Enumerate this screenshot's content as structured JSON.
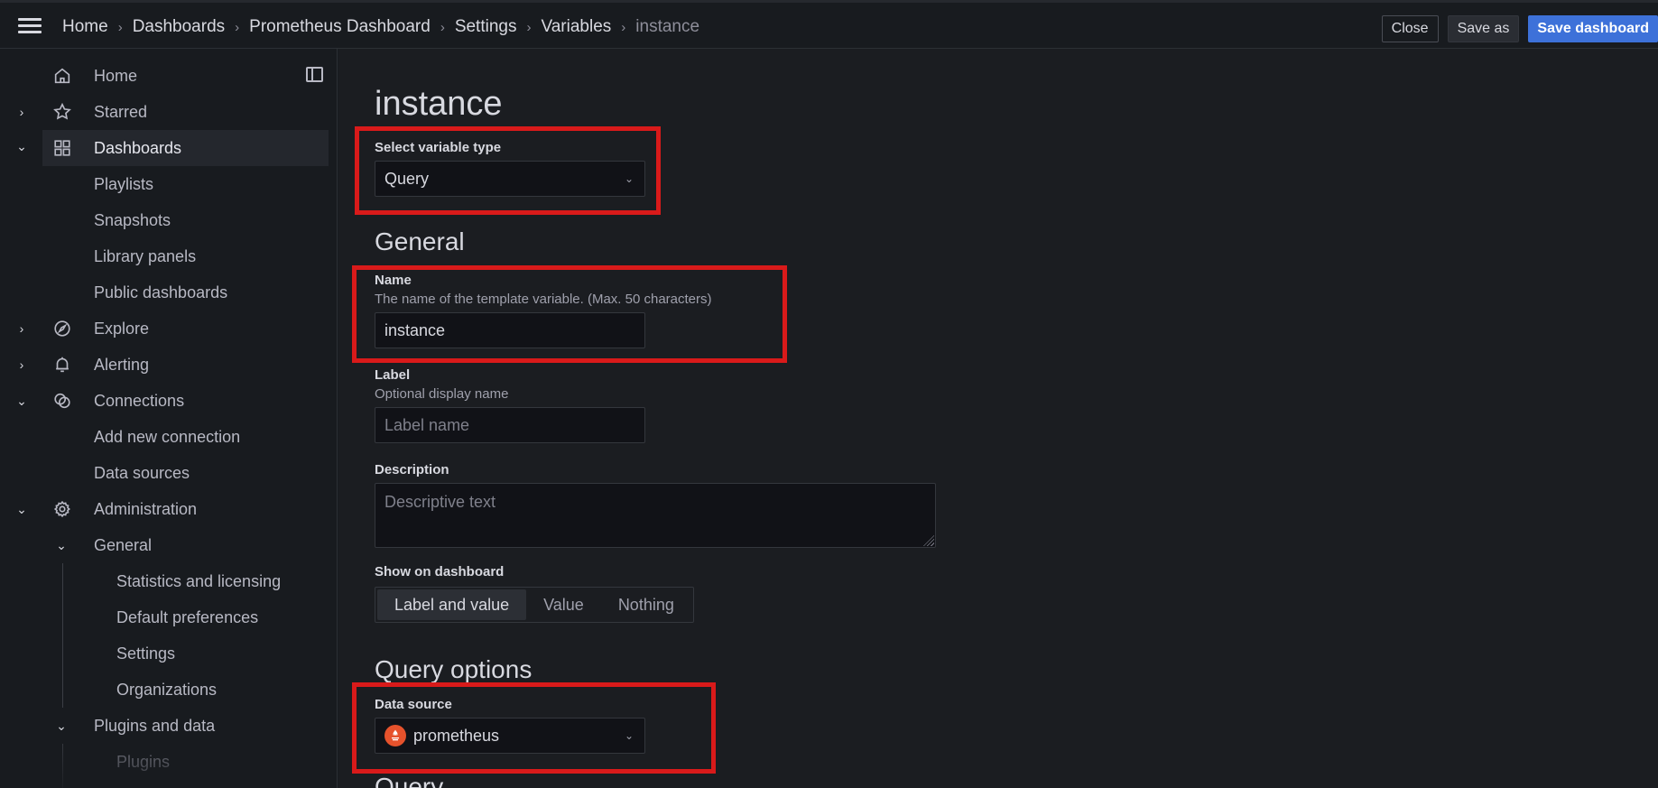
{
  "topbar": {
    "breadcrumbs": [
      "Home",
      "Dashboards",
      "Prometheus Dashboard",
      "Settings",
      "Variables",
      "instance"
    ],
    "actions": {
      "close": "Close",
      "save_as": "Save as",
      "save_dashboard": "Save dashboard"
    }
  },
  "sidebar": {
    "items": [
      {
        "label": "Home",
        "icon": "home-icon"
      },
      {
        "label": "Starred",
        "icon": "star-icon",
        "chevron": "right"
      },
      {
        "label": "Dashboards",
        "icon": "dashboards-grid-icon",
        "chevron": "down",
        "active": true
      },
      {
        "label": "Playlists"
      },
      {
        "label": "Snapshots"
      },
      {
        "label": "Library panels"
      },
      {
        "label": "Public dashboards"
      },
      {
        "label": "Explore",
        "icon": "compass-icon",
        "chevron": "right"
      },
      {
        "label": "Alerting",
        "icon": "bell-icon",
        "chevron": "right"
      },
      {
        "label": "Connections",
        "icon": "connections-icon",
        "chevron": "down"
      },
      {
        "label": "Add new connection"
      },
      {
        "label": "Data sources"
      },
      {
        "label": "Administration",
        "icon": "gear-icon",
        "chevron": "down"
      },
      {
        "label": "General",
        "chevron": "down"
      },
      {
        "label": "Statistics and licensing"
      },
      {
        "label": "Default preferences"
      },
      {
        "label": "Settings"
      },
      {
        "label": "Organizations"
      },
      {
        "label": "Plugins and data",
        "chevron": "down"
      },
      {
        "label": "Plugins"
      }
    ]
  },
  "main": {
    "title": "instance",
    "variable_type": {
      "label": "Select variable type",
      "value": "Query"
    },
    "general_heading": "General",
    "name_field": {
      "label": "Name",
      "description": "The name of the template variable. (Max. 50 characters)",
      "value": "instance"
    },
    "label_field": {
      "label": "Label",
      "description": "Optional display name",
      "placeholder": "Label name"
    },
    "description_field": {
      "label": "Description",
      "placeholder": "Descriptive text"
    },
    "show_on_dashboard": {
      "label": "Show on dashboard",
      "options": [
        "Label and value",
        "Value",
        "Nothing"
      ],
      "selected": "Label and value"
    },
    "query_options_heading": "Query options",
    "data_source": {
      "label": "Data source",
      "value": "prometheus",
      "icon_color": "#e6522c"
    },
    "query_heading": "Query"
  },
  "colors": {
    "accent": "#3d71d9",
    "active_indicator": "#f05a28",
    "highlight_box": "#d91a1a"
  }
}
